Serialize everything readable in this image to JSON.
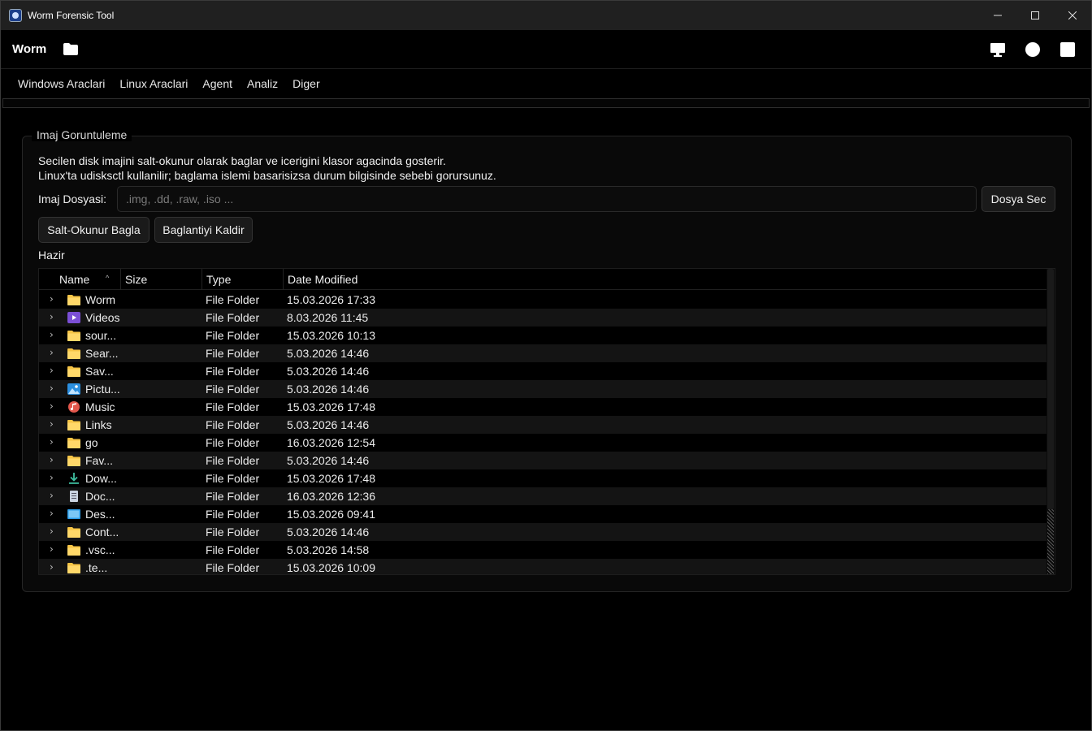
{
  "window": {
    "title": "Worm Forensic Tool"
  },
  "header": {
    "brand": "Worm"
  },
  "menu": [
    "Windows Araclari",
    "Linux Araclari",
    "Agent",
    "Analiz",
    "Diger"
  ],
  "group": {
    "title": "Imaj Goruntuleme",
    "desc_line1": "Secilen disk imajini salt-okunur olarak baglar ve icerigini klasor agacinda gosterir.",
    "desc_line2": "Linux'ta udisksctl kullanilir; baglama islemi basarisizsa durum bilgisinde sebebi gorursunuz.",
    "image_label": "Imaj Dosyasi:",
    "image_placeholder": ".img, .dd, .raw, .iso ...",
    "image_value": "",
    "browse_button": "Dosya Sec",
    "mount_button": "Salt-Okunur Bagla",
    "unmount_button": "Baglantiyi Kaldir",
    "status": "Hazir"
  },
  "tree": {
    "columns": {
      "name": "Name",
      "size": "Size",
      "type": "Type",
      "date": "Date Modified"
    },
    "rows": [
      {
        "name": "Worm",
        "size": "",
        "type": "File Folder",
        "date": "15.03.2026 17:33",
        "icon": "folder-icon"
      },
      {
        "name": "Videos",
        "size": "",
        "type": "File Folder",
        "date": "8.03.2026 11:45",
        "icon": "videos-folder-icon"
      },
      {
        "name": "sour...",
        "size": "",
        "type": "File Folder",
        "date": "15.03.2026 10:13",
        "icon": "folder-icon"
      },
      {
        "name": "Sear...",
        "size": "",
        "type": "File Folder",
        "date": "5.03.2026 14:46",
        "icon": "folder-icon"
      },
      {
        "name": "Sav...",
        "size": "",
        "type": "File Folder",
        "date": "5.03.2026 14:46",
        "icon": "folder-icon"
      },
      {
        "name": "Pictu...",
        "size": "",
        "type": "File Folder",
        "date": "5.03.2026 14:46",
        "icon": "pictures-folder-icon"
      },
      {
        "name": "Music",
        "size": "",
        "type": "File Folder",
        "date": "15.03.2026 17:48",
        "icon": "music-folder-icon"
      },
      {
        "name": "Links",
        "size": "",
        "type": "File Folder",
        "date": "5.03.2026 14:46",
        "icon": "folder-icon"
      },
      {
        "name": "go",
        "size": "",
        "type": "File Folder",
        "date": "16.03.2026 12:54",
        "icon": "folder-icon"
      },
      {
        "name": "Fav...",
        "size": "",
        "type": "File Folder",
        "date": "5.03.2026 14:46",
        "icon": "folder-icon"
      },
      {
        "name": "Dow...",
        "size": "",
        "type": "File Folder",
        "date": "15.03.2026 17:48",
        "icon": "downloads-folder-icon"
      },
      {
        "name": "Doc...",
        "size": "",
        "type": "File Folder",
        "date": "16.03.2026 12:36",
        "icon": "documents-folder-icon"
      },
      {
        "name": "Des...",
        "size": "",
        "type": "File Folder",
        "date": "15.03.2026 09:41",
        "icon": "desktop-folder-icon"
      },
      {
        "name": "Cont...",
        "size": "",
        "type": "File Folder",
        "date": "5.03.2026 14:46",
        "icon": "folder-icon"
      },
      {
        "name": ".vsc...",
        "size": "",
        "type": "File Folder",
        "date": "5.03.2026 14:58",
        "icon": "folder-icon"
      },
      {
        "name": ".te...",
        "size": "",
        "type": "File Folder",
        "date": "15.03.2026 10:09",
        "icon": "folder-icon"
      }
    ]
  },
  "colors": {
    "folder": "#f6c445",
    "background": "#000000",
    "row_alt": "#141414"
  }
}
